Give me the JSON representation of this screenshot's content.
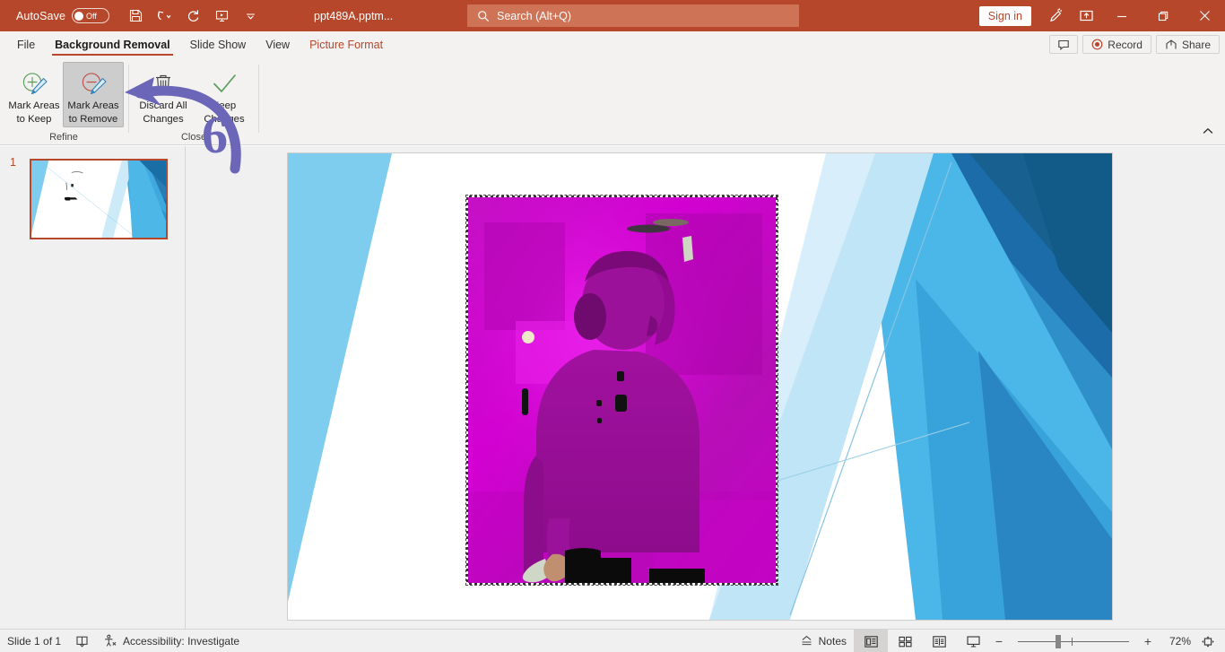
{
  "titlebar": {
    "autosave_label": "AutoSave",
    "autosave_state": "Off",
    "document_title": "ppt489A.pptm...",
    "quick_access": [
      {
        "name": "save-icon",
        "label": "Save"
      },
      {
        "name": "undo-icon",
        "label": "Undo"
      },
      {
        "name": "redo-icon",
        "label": "Repeat"
      },
      {
        "name": "start-presentation-icon",
        "label": "Start From Beginning"
      },
      {
        "name": "chevron-down-icon",
        "label": "Customize Quick Access Toolbar"
      }
    ],
    "search_placeholder": "Search (Alt+Q)",
    "sign_in_label": "Sign in",
    "right_icons": [
      {
        "name": "draw-pen-icon",
        "label": "Draw"
      },
      {
        "name": "ribbon-display-options-icon",
        "label": "Ribbon Display Options"
      }
    ],
    "window_controls": [
      {
        "name": "minimize-button",
        "glyph": "—"
      },
      {
        "name": "restore-button",
        "glyph": "❐"
      },
      {
        "name": "close-button",
        "glyph": "✕"
      }
    ],
    "accent_color": "#b7472a",
    "search_field_color": "#cf7356"
  },
  "tabs": [
    {
      "label": "File",
      "active": false,
      "contextual": false
    },
    {
      "label": "Background Removal",
      "active": true,
      "contextual": false
    },
    {
      "label": "Slide Show",
      "active": false,
      "contextual": false
    },
    {
      "label": "View",
      "active": false,
      "contextual": false
    },
    {
      "label": "Picture Format",
      "active": false,
      "contextual": true
    }
  ],
  "tabs_right": [
    {
      "name": "comments-button",
      "label": "",
      "icon": "comment-icon"
    },
    {
      "name": "record-button",
      "label": "Record",
      "icon": "record-icon"
    },
    {
      "name": "share-button",
      "label": "Share",
      "icon": "share-icon"
    }
  ],
  "ribbon": {
    "groups": [
      {
        "name": "refine",
        "label": "Refine",
        "buttons": [
          {
            "name": "mark-areas-to-keep-button",
            "line1": "Mark Areas",
            "line2": "to Keep",
            "icon": "mark-keep-icon",
            "selected": false
          },
          {
            "name": "mark-areas-to-remove-button",
            "line1": "Mark Areas",
            "line2": "to Remove",
            "icon": "mark-remove-icon",
            "selected": true
          }
        ]
      },
      {
        "name": "close",
        "label": "Close",
        "buttons": [
          {
            "name": "discard-all-changes-button",
            "line1": "Discard All",
            "line2": "Changes",
            "icon": "trash-icon",
            "selected": false
          },
          {
            "name": "keep-changes-button",
            "line1": "Keep",
            "line2": "Changes",
            "icon": "checkmark-icon",
            "selected": false
          }
        ]
      }
    ],
    "collapse_label": "Collapse the Ribbon"
  },
  "thumbnails": {
    "slides": [
      {
        "number": "1",
        "selected": true
      }
    ]
  },
  "annotation": {
    "step_number": "6",
    "arrow_color": "#6b66b8",
    "points_to": "mark-areas-to-remove-button"
  },
  "canvas": {
    "picture_name": "background-removal-preview-image",
    "removal_overlay_color": "#cc00cc"
  },
  "statusbar": {
    "slide_counter": "Slide 1 of 1",
    "language_icon": "spelling-icon",
    "accessibility_label": "Accessibility: Investigate",
    "notes_label": "Notes",
    "views": [
      {
        "name": "normal-view-button",
        "icon": "normal-view-icon",
        "active": true
      },
      {
        "name": "slide-sorter-view-button",
        "icon": "slide-sorter-icon",
        "active": false
      },
      {
        "name": "reading-view-button",
        "icon": "reading-view-icon",
        "active": false
      },
      {
        "name": "slide-show-button",
        "icon": "slide-show-icon",
        "active": false
      }
    ],
    "zoom_out_glyph": "−",
    "zoom_in_glyph": "+",
    "zoom_level": "72%",
    "fit_label": "Fit slide to current window"
  }
}
